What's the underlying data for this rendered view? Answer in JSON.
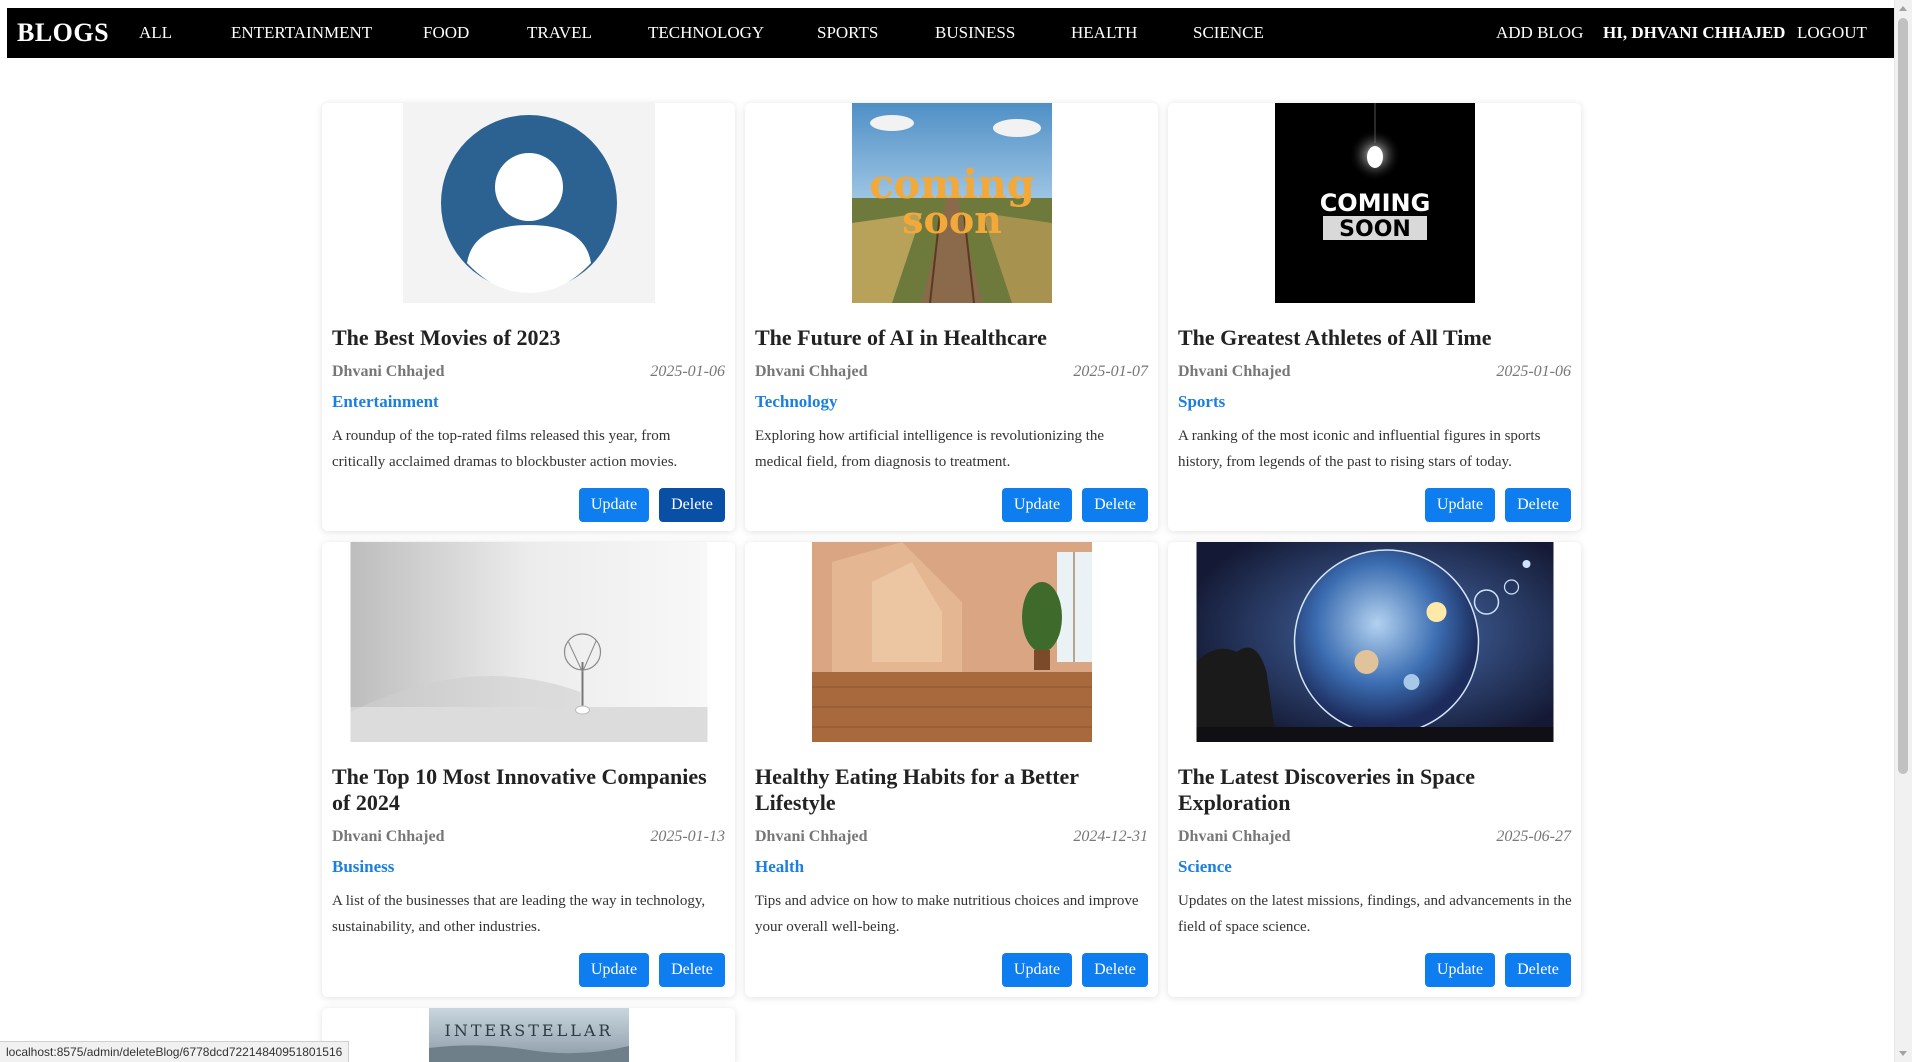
{
  "nav": {
    "brand": "BLOGS",
    "links": [
      "ALL",
      "ENTERTAINMENT",
      "FOOD",
      "TRAVEL",
      "TECHNOLOGY",
      "SPORTS",
      "BUSINESS",
      "HEALTH",
      "SCIENCE"
    ],
    "add_blog": "ADD BLOG",
    "user": "HI, DHVANI CHHAJED",
    "logout": "LOGOUT"
  },
  "cards": [
    {
      "title": "The Best Movies of 2023",
      "author": "Dhvani Chhajed",
      "date": "2025-01-06",
      "category": "Entertainment",
      "description": "A roundup of the top-rated films released this year, from critically acclaimed dramas to blockbuster action movies.",
      "update": "Update",
      "delete": "Delete",
      "image": "avatar-placeholder"
    },
    {
      "title": "The Future of AI in Healthcare",
      "author": "Dhvani Chhajed",
      "date": "2025-01-07",
      "category": "Technology",
      "description": "Exploring how artificial intelligence is revolutionizing the medical field, from diagnosis to treatment.",
      "update": "Update",
      "delete": "Delete",
      "image": "coming-soon-railway",
      "image_text": [
        "coming",
        "soon"
      ]
    },
    {
      "title": "The Greatest Athletes of All Time",
      "author": "Dhvani Chhajed",
      "date": "2025-01-06",
      "category": "Sports",
      "description": "A ranking of the most iconic and influential figures in sports history, from legends of the past to rising stars of today.",
      "update": "Update",
      "delete": "Delete",
      "image": "coming-soon-lightbulb",
      "image_text": [
        "COMING",
        "SOON"
      ]
    },
    {
      "title": "The Top 10 Most Innovative Companies of 2024",
      "author": "Dhvani Chhajed",
      "date": "2025-01-13",
      "category": "Business",
      "description": "A list of the businesses that are leading the way in technology, sustainability, and other industries.",
      "update": "Update",
      "delete": "Delete",
      "image": "minimal-tree"
    },
    {
      "title": "Healthy Eating Habits for a Better Lifestyle",
      "author": "Dhvani Chhajed",
      "date": "2024-12-31",
      "category": "Health",
      "description": "Tips and advice on how to make nutritious choices and improve your overall well-being.",
      "update": "Update",
      "delete": "Delete",
      "image": "sunlit-room"
    },
    {
      "title": "The Latest Discoveries in Space Exploration",
      "author": "Dhvani Chhajed",
      "date": "2025-06-27",
      "category": "Science",
      "description": "Updates on the latest missions, findings, and advancements in the field of space science.",
      "update": "Update",
      "delete": "Delete",
      "image": "space-bubble"
    },
    {
      "image": "interstellar-poster",
      "image_text": "INTERSTELLAR"
    }
  ],
  "status_url": "localhost:8575/admin/deleteBlog/6778dcd72214840951801516",
  "colors": {
    "navbar": "#000000",
    "accent": "#0d7df0",
    "delete_hover": "#0a4fa6",
    "category": "#1a7fe0"
  }
}
